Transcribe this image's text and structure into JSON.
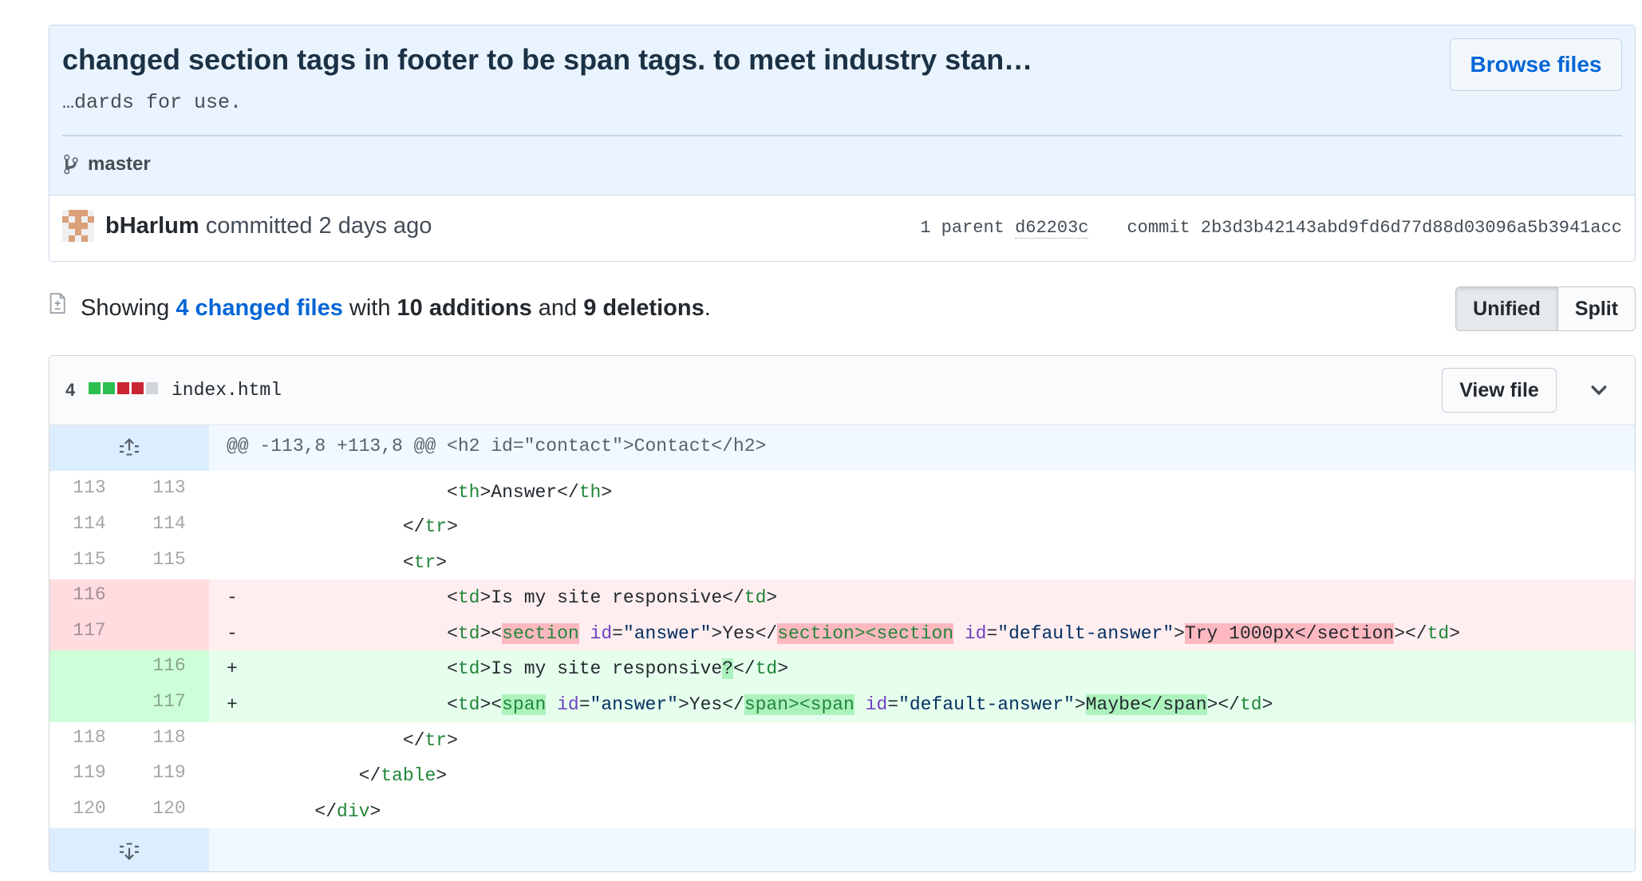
{
  "commit": {
    "title": "changed section tags in footer to be span tags. to meet industry stan…",
    "description": "…dards for use.",
    "browse_label": "Browse files",
    "branch": "master",
    "author": "bHarlum",
    "committed_text": " committed 2 days ago",
    "parent_label": "1 parent",
    "parent_sha": "d62203c",
    "commit_label": "commit",
    "commit_sha": "2b3d3b42143abd9fd6d77d88d03096a5b3941acc"
  },
  "summary": {
    "showing": "Showing ",
    "changed_files": "4 changed files",
    "with": " with ",
    "additions": "10 additions",
    "and": " and ",
    "deletions": "9 deletions",
    "end": "."
  },
  "view_toggle": {
    "unified": "Unified",
    "split": "Split"
  },
  "file": {
    "change_count": "4",
    "diffstat": [
      "add",
      "add",
      "del",
      "del",
      "neutral"
    ],
    "name": "index.html",
    "view_file_label": "View file",
    "hunk_header": "@@ -113,8 +113,8 @@ <h2 id=\"contact\">Contact</h2>",
    "lines": [
      {
        "type": "ctx",
        "old": "113",
        "new": "113"
      },
      {
        "type": "ctx",
        "old": "114",
        "new": "114"
      },
      {
        "type": "ctx",
        "old": "115",
        "new": "115"
      },
      {
        "type": "del",
        "old": "116",
        "new": "",
        "marker": "-"
      },
      {
        "type": "del",
        "old": "117",
        "new": "",
        "marker": "-"
      },
      {
        "type": "add",
        "old": "",
        "new": "116",
        "marker": "+"
      },
      {
        "type": "add",
        "old": "",
        "new": "117",
        "marker": "+"
      },
      {
        "type": "ctx",
        "old": "118",
        "new": "118"
      },
      {
        "type": "ctx",
        "old": "119",
        "new": "119"
      },
      {
        "type": "ctx",
        "old": "120",
        "new": "120"
      }
    ],
    "code": {
      "l113": {
        "lt": "<",
        "tag": "th",
        "gt": ">",
        "text": "Answer",
        "close_lt": "</",
        "close_tag": "th",
        "close_gt": ">"
      },
      "l114": {
        "lt": "</",
        "tag": "tr",
        "gt": ">"
      },
      "l115": {
        "lt": "<",
        "tag": "tr",
        "gt": ">"
      },
      "l116_old": {
        "lt": "<",
        "tag": "td",
        "gt": ">",
        "text": "Is my site responsive",
        "close_lt": "</",
        "close_tag": "td",
        "close_gt": ">"
      },
      "l117_old": {
        "p1": "<",
        "td": "td",
        "p2": "><",
        "section1": "section",
        "sp": " ",
        "id": "id",
        "eq": "=",
        "answer": "\"answer\"",
        "gt": ">",
        "yes": "Yes",
        "p3": "</",
        "section2": "section><section",
        "sp2": " ",
        "id2": "id",
        "eq2": "=",
        "default_answer": "\"default-answer\"",
        "gt2": ">",
        "try": "Try 1000px</section",
        "gt3": "></",
        "td2": "td",
        "gt4": ">"
      },
      "l116_new": {
        "lt": "<",
        "tag": "td",
        "gt": ">",
        "text": "Is my site responsive",
        "q": "?",
        "close_lt": "</",
        "close_tag": "td",
        "close_gt": ">"
      },
      "l117_new": {
        "p1": "<",
        "td": "td",
        "p2": "><",
        "span1": "span",
        "sp": " ",
        "id": "id",
        "eq": "=",
        "answer": "\"answer\"",
        "gt": ">",
        "yes": "Yes",
        "p3": "</",
        "span2": "span><span",
        "sp2": " ",
        "id2": "id",
        "eq2": "=",
        "default_answer": "\"default-answer\"",
        "gt2": ">",
        "maybe": "Maybe</span",
        "gt3": "></",
        "td2": "td",
        "gt4": ">"
      },
      "l118": {
        "lt": "</",
        "tag": "tr",
        "gt": ">"
      },
      "l119": {
        "lt": "</",
        "tag": "table",
        "gt": ">"
      },
      "l120": {
        "lt": "</",
        "tag": "div",
        "gt": ">"
      }
    }
  },
  "colors": {
    "addition": "#2cbe4e",
    "deletion": "#cb2431",
    "neutral": "#d1d5da",
    "link": "#0366d6"
  },
  "icons": [
    "git-branch-icon",
    "diff-icon",
    "unfold-up-icon",
    "unfold-down-icon",
    "chevron-down-icon",
    "avatar-identicon"
  ]
}
